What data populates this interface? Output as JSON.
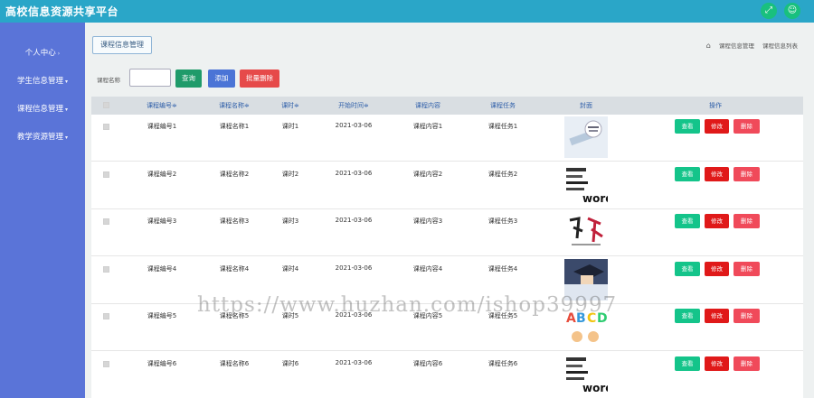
{
  "app": {
    "title": "高校信息资源共享平台"
  },
  "topbar": {
    "icon_left": "expand-icon",
    "icon_right": "user-icon"
  },
  "sidebar": {
    "items": [
      {
        "label": "个人中心"
      },
      {
        "label": "学生信息管理"
      },
      {
        "label": "课程信息管理"
      },
      {
        "label": "教学资源管理"
      }
    ]
  },
  "content": {
    "crumb_label": "课程信息管理",
    "breadcrumb": [
      "课程信息管理",
      "课程信息列表"
    ]
  },
  "search": {
    "label": "课程名称",
    "value": "",
    "placeholder": "",
    "query_label": "查询",
    "add_label": "添加",
    "batch_delete_label": "批量删除"
  },
  "table": {
    "headers": [
      "课程编号≑",
      "课程名称≑",
      "课时≑",
      "开始时间≑",
      "课程内容",
      "课程任务",
      "封面",
      "操作"
    ],
    "rows": [
      {
        "code": "课程编号1",
        "name": "课程名称1",
        "hours": "课时1",
        "start": "2021-03-06",
        "content": "课程内容1",
        "task": "课程任务1"
      },
      {
        "code": "课程编号2",
        "name": "课程名称2",
        "hours": "课时2",
        "start": "2021-03-06",
        "content": "课程内容2",
        "task": "课程任务2"
      },
      {
        "code": "课程编号3",
        "name": "课程名称3",
        "hours": "课时3",
        "start": "2021-03-06",
        "content": "课程内容3",
        "task": "课程任务3"
      },
      {
        "code": "课程编号4",
        "name": "课程名称4",
        "hours": "课时4",
        "start": "2021-03-06",
        "content": "课程内容4",
        "task": "课程任务4"
      },
      {
        "code": "课程编号5",
        "name": "课程名称5",
        "hours": "课时5",
        "start": "2021-03-06",
        "content": "课程内容5",
        "task": "课程任务5"
      },
      {
        "code": "课程编号6",
        "name": "课程名称6",
        "hours": "课时6",
        "start": "2021-03-06",
        "content": "课程内容6",
        "task": "课程任务6"
      }
    ],
    "actions": {
      "view": "查看",
      "edit": "修改",
      "delete": "删除"
    }
  },
  "watermark": "https://www.huzhan.com/ishop39997",
  "colors": {
    "topbar": "#2aa6c8",
    "sidebar": "#5a74d8",
    "view": "#14c48a",
    "edit": "#e01919",
    "delete": "#f04a5a"
  }
}
